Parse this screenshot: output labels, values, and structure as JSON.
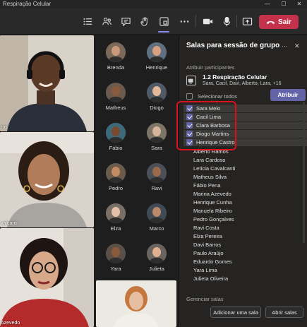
{
  "window": {
    "title": "Respiração Celular",
    "minimize": "—",
    "maximize": "☐",
    "close": "✕"
  },
  "toolbar": {
    "leave_label": "Sair"
  },
  "stage": {
    "tiles": [
      {
        "name": "ros"
      },
      {
        "name": "valcanti"
      },
      {
        "name": "Azevedo"
      }
    ],
    "gallery": [
      {
        "name": "Brenda",
        "bg": "#7b6a5a",
        "skin": "#c99a7a"
      },
      {
        "name": "Henrique",
        "bg": "#5f6f7f",
        "skin": "#d6a07f"
      },
      {
        "name": "Matheus",
        "bg": "#6b5a4d",
        "skin": "#8a5a3c"
      },
      {
        "name": "Diogo",
        "bg": "#4f5a66",
        "skin": "#e2b89a"
      },
      {
        "name": "Fábio",
        "bg": "#3d6a7a",
        "skin": "#7a4a30"
      },
      {
        "name": "Sara",
        "bg": "#7c7464",
        "skin": "#d7b59c"
      },
      {
        "name": "Pedro",
        "bg": "#6a5b4c",
        "skin": "#c48a62"
      },
      {
        "name": "Ravi",
        "bg": "#4a4f58",
        "skin": "#9a6a4a"
      },
      {
        "name": "Elza",
        "bg": "#7a6f66",
        "skin": "#e4c0a8"
      },
      {
        "name": "Marco",
        "bg": "#3f4a55",
        "skin": "#b98a6a"
      },
      {
        "name": "Yara",
        "bg": "#5a5048",
        "skin": "#8b5a3a"
      },
      {
        "name": "Julieta",
        "bg": "#6a6460",
        "skin": "#e0b090"
      }
    ]
  },
  "panel": {
    "title": "Salas para sessão de grupo",
    "more": "···",
    "close": "✕",
    "assign_section": "Atribuir participantes",
    "room_name": "1.2 Respiração Celular",
    "room_members": "Sara, Cacil, Davi, Alberto, Lara, +16",
    "select_all": "Selecionar todos",
    "assign_button": "Atribuir",
    "selected": [
      "Sara Melo",
      "Cacil Lima",
      "Clara Barbosa",
      "Diogo Martins",
      "Henrique Castro"
    ],
    "others": [
      "Alberto Ramos",
      "Lara Cardoso",
      "Letícia Cavalcanti",
      "Matheus Silva",
      "Fábio Pena",
      "Marina Azevedo",
      "Henrique Cunha",
      "Manuela Ribeiro",
      "Pedro Gonçalves",
      "Ravi Costa",
      "Elza Pereira",
      "Davi Barros",
      "Paulo Araújo",
      "Eduardo Gomes",
      "Yara Lima",
      "Julieta Oliveira"
    ],
    "manage_section": "Gerenciar salas",
    "add_room": "Adicionar uma sala",
    "open_rooms": "Abrir salas"
  },
  "colors": {
    "accent": "#6264a7",
    "leave": "#c4314b",
    "highlight": "#e0101b"
  }
}
